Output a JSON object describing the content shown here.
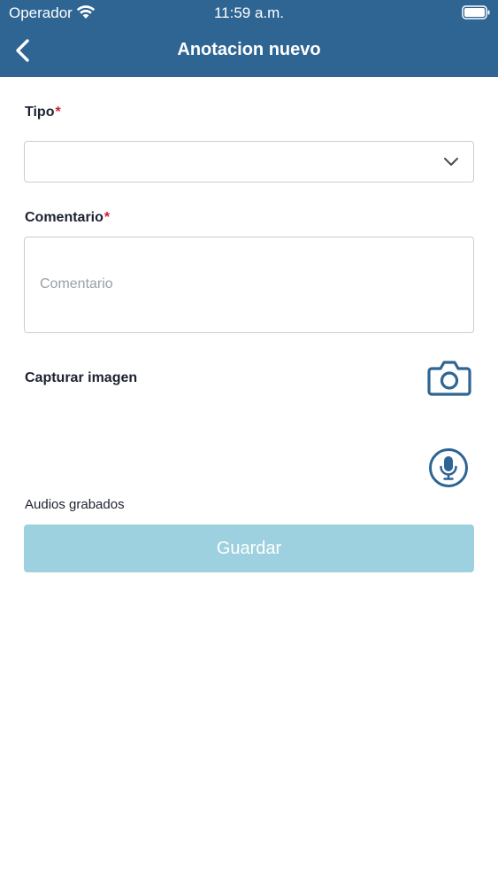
{
  "status_bar": {
    "carrier": "Operador",
    "time": "11:59 a.m."
  },
  "nav": {
    "title": "Anotacion nuevo",
    "back_icon": "chevron-left-icon"
  },
  "form": {
    "tipo": {
      "label": "Tipo",
      "required_mark": "*",
      "value": ""
    },
    "comentario": {
      "label": "Comentario",
      "required_mark": "*",
      "placeholder": "Comentario",
      "value": ""
    },
    "capture": {
      "label": "Capturar imagen",
      "icon": "camera-icon"
    },
    "audio": {
      "icon": "microphone-icon",
      "label": "Audios grabados"
    },
    "save_label": "Guardar"
  },
  "colors": {
    "header": "#2e6593",
    "accent": "#2e6593",
    "required": "#d0202e",
    "save_disabled": "#9dd1df"
  }
}
